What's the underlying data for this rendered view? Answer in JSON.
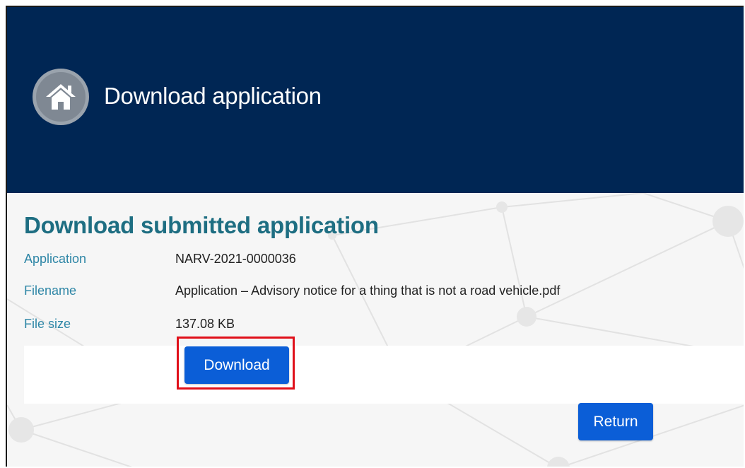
{
  "header": {
    "title": "Download application",
    "icon": "home-icon"
  },
  "section": {
    "title": "Download submitted application"
  },
  "details": [
    {
      "label": "Application",
      "value": "NARV-2021-0000036"
    },
    {
      "label": "Filename",
      "value": "Application – Advisory notice for a thing that is not a road vehicle.pdf"
    },
    {
      "label": "File size",
      "value": "137.08 KB"
    }
  ],
  "buttons": {
    "download_label": "Download",
    "return_label": "Return"
  },
  "colors": {
    "header_bg": "#002654",
    "title_teal": "#1e6e82",
    "label_blue": "#2e86a6",
    "button_blue": "#0b5ed7",
    "highlight_red": "#e0101a"
  }
}
